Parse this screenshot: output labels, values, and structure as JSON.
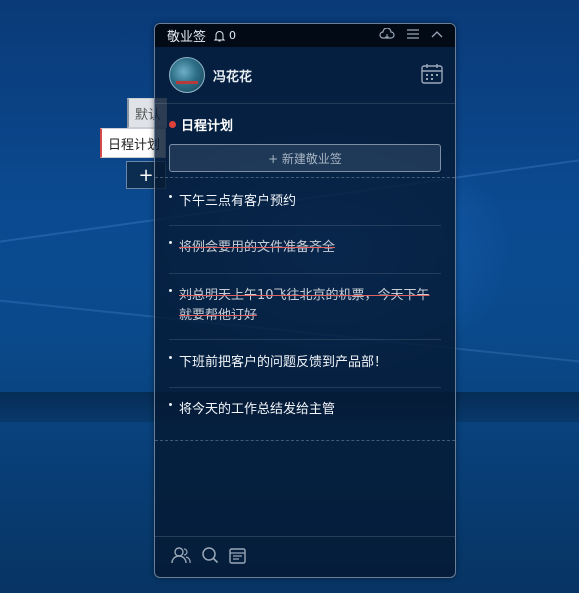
{
  "side_tabs": {
    "default_label": "默认",
    "schedule_label": "日程计划",
    "add_label": "+"
  },
  "widget": {
    "app_title": "敬业签",
    "notification_count": "0",
    "user": {
      "name": "冯花花"
    },
    "section": {
      "title": "日程计划"
    },
    "new_button": "+ 新建敬业签",
    "items": [
      {
        "text": "下午三点有客户预约",
        "done": false
      },
      {
        "text": "将例会要用的文件准备齐全",
        "done": true
      },
      {
        "text": "刘总明天上午10飞往北京的机票，今天下午就要帮他订好",
        "done": true
      },
      {
        "text": "下班前把客户的问题反馈到产品部！",
        "done": false
      },
      {
        "text": "将今天的工作总结发给主管",
        "done": false
      }
    ],
    "icons": {
      "bell": "bell-icon",
      "cloud": "cloud-icon",
      "menu": "menu-icon",
      "collapse": "chevron-up-icon",
      "calendar": "calendar-icon",
      "contacts": "contacts-icon",
      "search": "search-icon",
      "notes": "notes-icon"
    },
    "colors": {
      "accent_red": "#e0403b",
      "panel": "#05182f"
    }
  }
}
